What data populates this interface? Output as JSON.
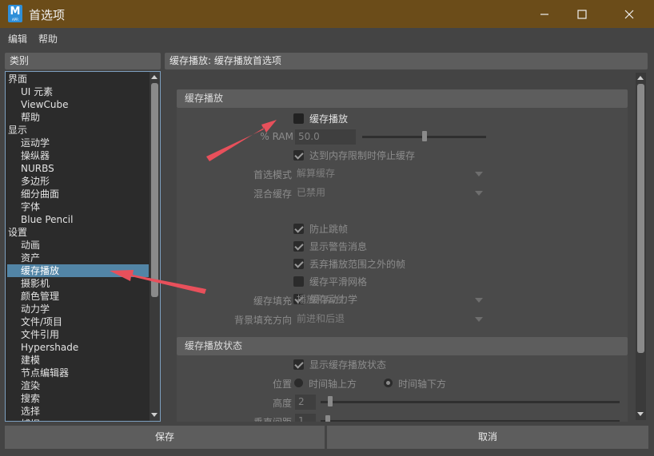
{
  "window": {
    "title": "首选项",
    "icon_letter": "M",
    "icon_sub": "APR",
    "controls": [
      "minimize-icon",
      "maximize-icon",
      "close-icon"
    ]
  },
  "menu": [
    "编辑",
    "帮助"
  ],
  "left": {
    "header": "类别",
    "items": [
      {
        "label": "界面",
        "level": 0,
        "selected": false
      },
      {
        "label": "UI 元素",
        "level": 1,
        "selected": false
      },
      {
        "label": "ViewCube",
        "level": 1,
        "selected": false
      },
      {
        "label": "帮助",
        "level": 1,
        "selected": false
      },
      {
        "label": "显示",
        "level": 0,
        "selected": false
      },
      {
        "label": "运动学",
        "level": 1,
        "selected": false
      },
      {
        "label": "操纵器",
        "level": 1,
        "selected": false
      },
      {
        "label": "NURBS",
        "level": 1,
        "selected": false
      },
      {
        "label": "多边形",
        "level": 1,
        "selected": false
      },
      {
        "label": "细分曲面",
        "level": 1,
        "selected": false
      },
      {
        "label": "字体",
        "level": 1,
        "selected": false
      },
      {
        "label": "Blue Pencil",
        "level": 1,
        "selected": false
      },
      {
        "label": "设置",
        "level": 0,
        "selected": false
      },
      {
        "label": "动画",
        "level": 1,
        "selected": false
      },
      {
        "label": "资产",
        "level": 1,
        "selected": false
      },
      {
        "label": "缓存播放",
        "level": 1,
        "selected": true
      },
      {
        "label": "摄影机",
        "level": 1,
        "selected": false
      },
      {
        "label": "颜色管理",
        "level": 1,
        "selected": false
      },
      {
        "label": "动力学",
        "level": 1,
        "selected": false
      },
      {
        "label": "文件/项目",
        "level": 1,
        "selected": false
      },
      {
        "label": "文件引用",
        "level": 1,
        "selected": false
      },
      {
        "label": "Hypershade",
        "level": 1,
        "selected": false
      },
      {
        "label": "建模",
        "level": 1,
        "selected": false
      },
      {
        "label": "节点编辑器",
        "level": 1,
        "selected": false
      },
      {
        "label": "渲染",
        "level": 1,
        "selected": false
      },
      {
        "label": "搜索",
        "level": 1,
        "selected": false
      },
      {
        "label": "选择",
        "level": 1,
        "selected": false
      },
      {
        "label": "捕捉",
        "level": 1,
        "selected": false
      }
    ]
  },
  "right": {
    "header": "缓存播放: 缓存播放首选项",
    "section1": {
      "title": "缓存播放",
      "enable": {
        "label": "缓存播放",
        "checked": false
      },
      "ram": {
        "label": "% RAM",
        "value": "50.0",
        "fraction": 0.5
      },
      "stop_on_limit": {
        "label": "达到内存限制时停止缓存",
        "checked": true
      },
      "preferred_mode": {
        "label": "首选模式",
        "value": "解算缓存"
      },
      "blend_cache": {
        "label": "混合缓存",
        "value": "已禁用"
      },
      "checks": [
        {
          "label": "防止跳帧",
          "checked": true
        },
        {
          "label": "显示警告消息",
          "checked": true
        },
        {
          "label": "丢弃播放范围之外的帧",
          "checked": true
        },
        {
          "label": "缓存平滑网格",
          "checked": false
        },
        {
          "label": "缓存动力学",
          "checked": true
        }
      ],
      "cache_fill": {
        "label": "缓存填充",
        "value": "播放和后台"
      },
      "bg_fill_direction": {
        "label": "背景填充方向",
        "value": "前进和后退"
      }
    },
    "section2": {
      "title": "缓存播放状态",
      "show_status": {
        "label": "显示缓存播放状态",
        "checked": true
      },
      "position": {
        "label": "位置",
        "options": [
          "时间轴上方",
          "时间轴下方"
        ],
        "selected": 1
      },
      "height": {
        "label": "高度",
        "value": "2"
      },
      "vertical_spacing": {
        "label": "垂直间距",
        "value": "1"
      }
    }
  },
  "buttons": {
    "save": "保存",
    "cancel": "取消"
  },
  "colors": {
    "titlebar": "#6b4c19",
    "selection": "#5285a6",
    "annotation_arrow": "#e8505b",
    "list_bg": "#2b2b2b"
  }
}
